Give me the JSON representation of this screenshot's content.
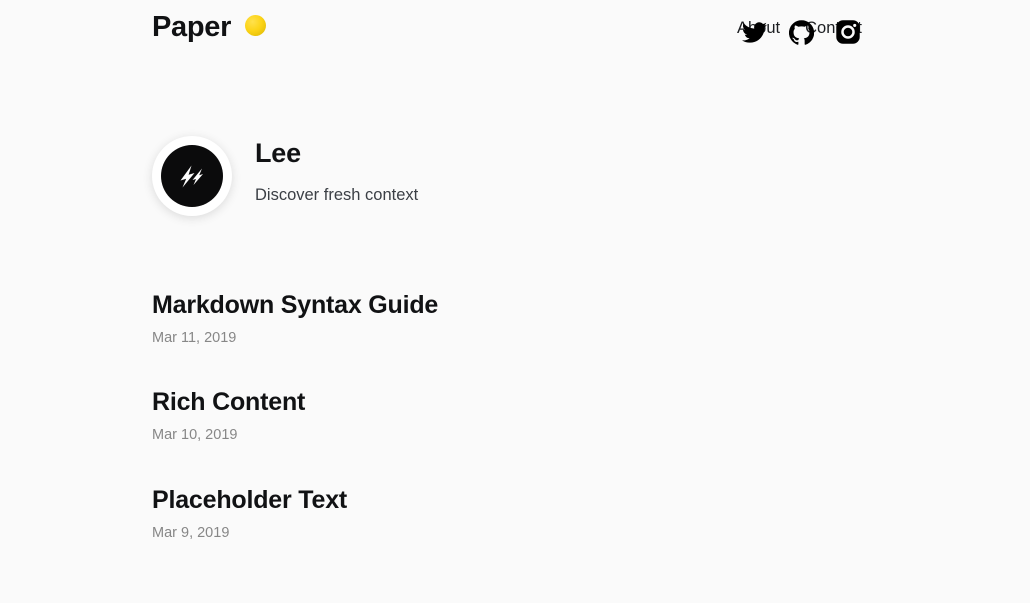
{
  "site": {
    "background_color": "#fafafa",
    "text_color": "#1c1e21",
    "muted_color": "#878787"
  },
  "header": {
    "brand_name": "Paper",
    "brand_emoji": "🌕",
    "brand_emoji_name": "full-moon-emoji",
    "nav_links": [
      {
        "label": "About"
      },
      {
        "label": "Contact"
      }
    ],
    "social_links": [
      {
        "name": "twitter-icon",
        "label": "Twitter"
      },
      {
        "name": "github-icon",
        "label": "GitHub"
      },
      {
        "name": "instagram-icon",
        "label": "Instagram"
      }
    ]
  },
  "profile": {
    "avatar_icon": "lightning-bolt-icon",
    "name": "Lee",
    "tagline": "Discover fresh context"
  },
  "posts": [
    {
      "title": "Markdown Syntax Guide",
      "date": "Mar 11, 2019"
    },
    {
      "title": "Rich Content",
      "date": "Mar 10, 2019"
    },
    {
      "title": "Placeholder Text",
      "date": "Mar 9, 2019"
    }
  ]
}
